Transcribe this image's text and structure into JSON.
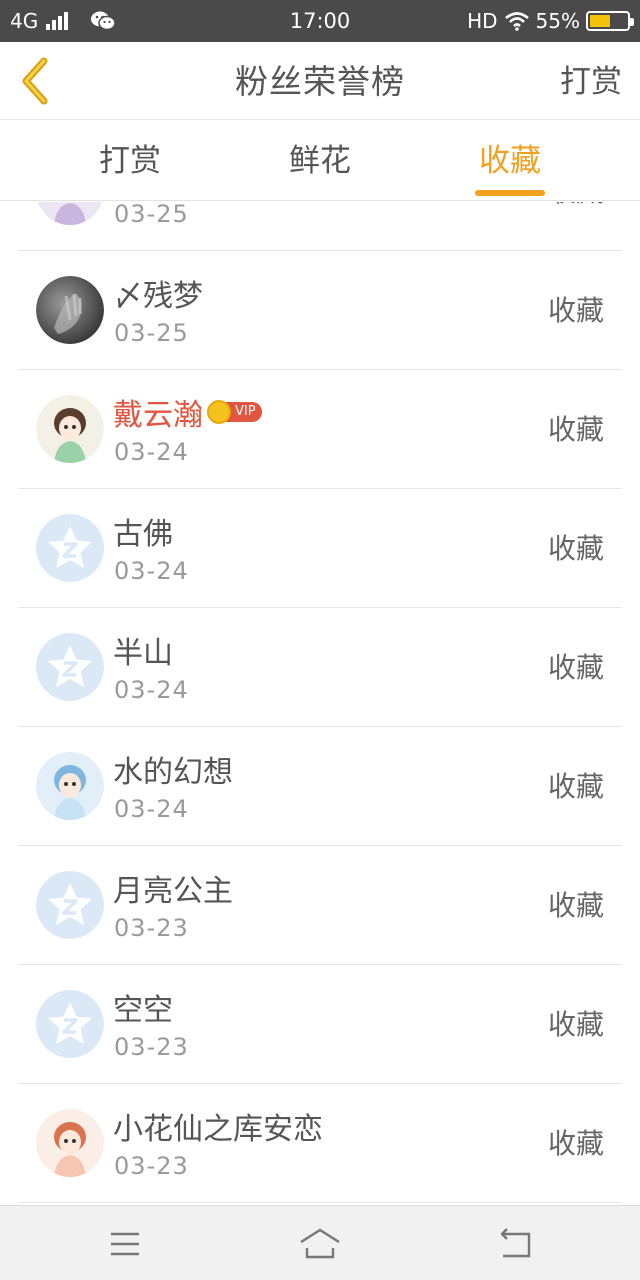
{
  "status_bar": {
    "network": "4G",
    "time": "17:00",
    "hd": "HD",
    "battery": "55%",
    "battery_level": 0.55,
    "icons": [
      "signal-icon",
      "wechat-icon",
      "wifi-icon",
      "battery-icon"
    ]
  },
  "header": {
    "title": "粉丝荣誉榜",
    "right_action": "打赏",
    "back_icon": "back-chevron-icon"
  },
  "tabs": [
    {
      "label": "打赏",
      "active": false
    },
    {
      "label": "鲜花",
      "active": false
    },
    {
      "label": "收藏",
      "active": true
    }
  ],
  "list": {
    "action_label": "收藏",
    "rows": [
      {
        "name": "",
        "date": "03-25",
        "action": "收藏",
        "avatar": "anime-avatar"
      },
      {
        "name": "〆残梦",
        "date": "03-25",
        "action": "收藏",
        "avatar": "photo-avatar"
      },
      {
        "name": "戴云瀚",
        "date": "03-24",
        "action": "收藏",
        "avatar": "anime-avatar",
        "vip": true,
        "vip_label": "VIP"
      },
      {
        "name": "古佛",
        "date": "03-24",
        "action": "收藏",
        "avatar": "default-avatar"
      },
      {
        "name": "半山",
        "date": "03-24",
        "action": "收藏",
        "avatar": "default-avatar"
      },
      {
        "name": "水的幻想",
        "date": "03-24",
        "action": "收藏",
        "avatar": "anime-avatar"
      },
      {
        "name": "月亮公主",
        "date": "03-23",
        "action": "收藏",
        "avatar": "default-avatar"
      },
      {
        "name": "空空",
        "date": "03-23",
        "action": "收藏",
        "avatar": "default-avatar"
      },
      {
        "name": "小花仙之库安恋",
        "date": "03-23",
        "action": "收藏",
        "avatar": "anime-avatar"
      }
    ]
  },
  "nav_bar": {
    "icons": [
      "menu-icon",
      "home-icon",
      "back-icon"
    ]
  },
  "colors": {
    "accent": "#f0a11d",
    "vip_name": "#e2553e",
    "status_bar_bg": "#4a4a4a",
    "default_avatar": "#dbe8f6"
  }
}
